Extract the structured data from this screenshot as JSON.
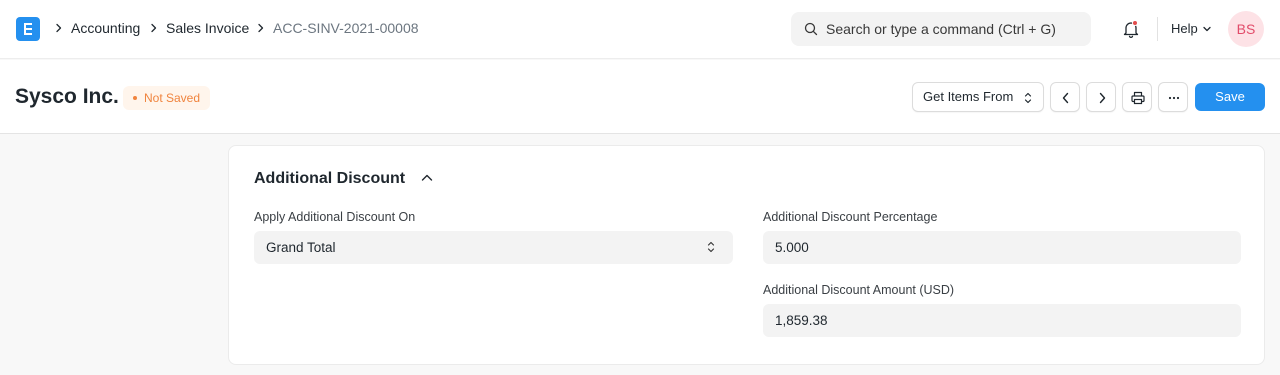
{
  "navbar": {
    "logo_letter": "E",
    "breadcrumbs": [
      "Accounting",
      "Sales Invoice",
      "ACC-SINV-2021-00008"
    ],
    "search_placeholder": "Search or type a command (Ctrl + G)",
    "help_label": "Help",
    "avatar_initials": "BS"
  },
  "page": {
    "title": "Sysco Inc.",
    "status": "Not Saved",
    "get_items_label": "Get Items From",
    "save_label": "Save"
  },
  "section": {
    "title": "Additional Discount",
    "apply_on_label": "Apply Additional Discount On",
    "apply_on_value": "Grand Total",
    "percentage_label": "Additional Discount Percentage",
    "percentage_value": "5.000",
    "amount_label": "Additional Discount Amount (USD)",
    "amount_value": "1,859.38"
  },
  "colors": {
    "primary": "#2490ef",
    "status_warning": "#f0843e",
    "avatar_text": "#e24c6a"
  }
}
